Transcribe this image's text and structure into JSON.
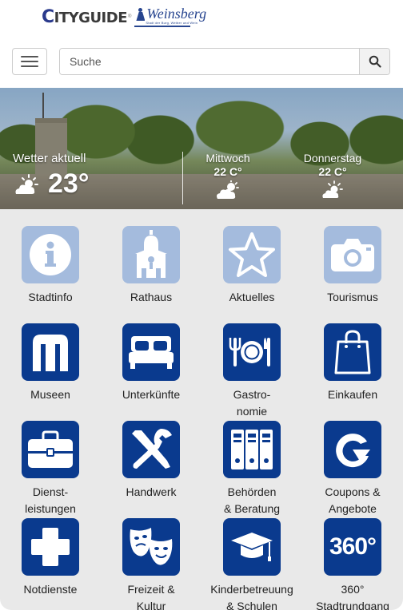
{
  "header": {
    "logo_city_first": "C",
    "logo_city_rest": "ITYGUIDE",
    "logo_registered": "®",
    "logo_town": "Weinsberg",
    "logo_tagline": "Stadt der Burg, Weiber und Wein",
    "menu_icon": "hamburger-icon",
    "search_placeholder": "Suche",
    "search_icon": "search-icon"
  },
  "weather": {
    "current_label": "Wetter aktuell",
    "current_temp": "23°",
    "current_icon": "sun-cloud-icon",
    "forecast": [
      {
        "day": "Mittwoch",
        "temp": "22 C°",
        "icon": "cloud-sun-icon"
      },
      {
        "day": "Donnerstag",
        "temp": "22 C°",
        "icon": "sun-cloud-icon"
      }
    ]
  },
  "tiles": [
    {
      "label": "Stadtinfo",
      "icon": "info-icon",
      "style": "light"
    },
    {
      "label": "Rathaus",
      "icon": "town-hall-icon",
      "style": "light"
    },
    {
      "label": "Aktuelles",
      "icon": "star-icon",
      "style": "light"
    },
    {
      "label": "Tourismus",
      "icon": "camera-icon",
      "style": "light"
    },
    {
      "label": "Museen",
      "icon": "museum-icon",
      "style": "dark"
    },
    {
      "label": "Unterkünfte",
      "icon": "bed-icon",
      "style": "dark"
    },
    {
      "label": "Gastro-\nnomie",
      "icon": "dining-icon",
      "style": "dark"
    },
    {
      "label": "Einkaufen",
      "icon": "shopping-bag-icon",
      "style": "dark"
    },
    {
      "label": "Dienst-\nleistungen",
      "icon": "briefcase-icon",
      "style": "dark"
    },
    {
      "label": "Handwerk",
      "icon": "tools-icon",
      "style": "dark"
    },
    {
      "label": "Behörden\n& Beratung",
      "icon": "binders-icon",
      "style": "dark"
    },
    {
      "label": "Coupons &\nAngebote",
      "icon": "coupon-icon",
      "style": "dark"
    },
    {
      "label": "Notdienste",
      "icon": "cross-icon",
      "style": "dark"
    },
    {
      "label": "Freizeit &\nKultur",
      "icon": "masks-icon",
      "style": "dark"
    },
    {
      "label": "Kinderbetreuung\n& Schulen",
      "icon": "graduation-cap-icon",
      "style": "dark"
    },
    {
      "label": "360°\nStadtrundgang",
      "icon": "360-icon",
      "style": "dark",
      "icon_text": "360°"
    }
  ],
  "colors": {
    "tile_light": "#a4bbdd",
    "tile_dark": "#0a3a8e",
    "grid_background": "#e9e9e9"
  }
}
